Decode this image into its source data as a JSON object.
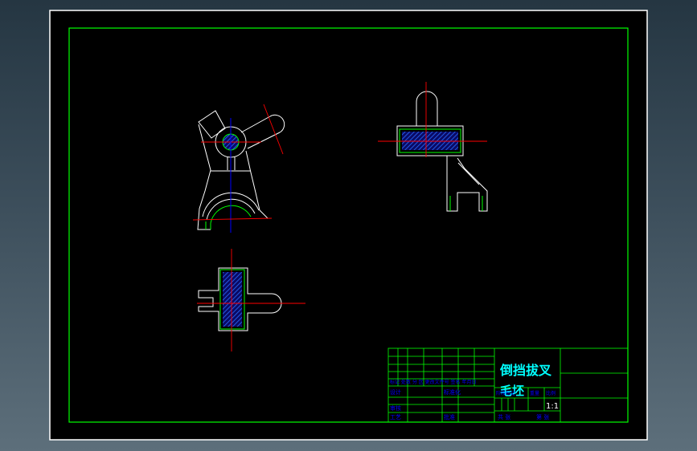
{
  "drawing": {
    "title_line1": "倒挡拔叉",
    "title_line2": "毛坯",
    "scale": "1:1",
    "small_labels": {
      "rev_row": "标记 处数 分 区 更改文件号 签名 年月日",
      "design": "设计",
      "standard": "标准化",
      "check": "审核",
      "craft": "工艺",
      "approve": "批准",
      "stage": "阶段标记",
      "weight": "重量",
      "ratio": "比例",
      "sheets_total": "共 张",
      "sheet_no": "第 张"
    }
  },
  "colors": {
    "background": "#000000",
    "border": "#ffffff",
    "frame": "#00ff00",
    "outline": "#ffffff",
    "centerline": "#ff0000",
    "hatch": "#0000ff",
    "section_edge": "#00ff00",
    "axis": "#0000ff",
    "title_text": "#00ffff",
    "table_text": "#0000ff"
  }
}
